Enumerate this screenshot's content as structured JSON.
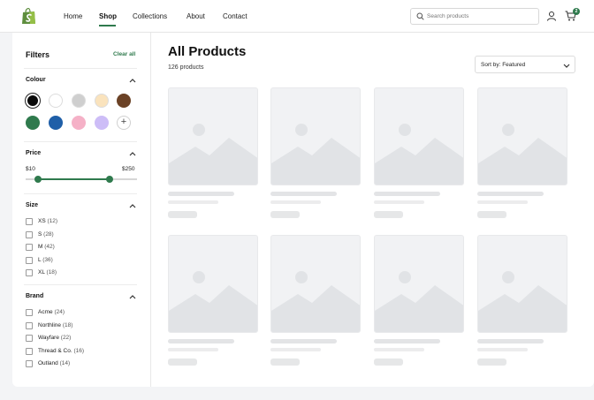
{
  "header": {
    "logo_icon": "shopify-bag-icon",
    "nav": [
      {
        "label": "Home",
        "active": false
      },
      {
        "label": "Shop",
        "active": true
      },
      {
        "label": "Collections",
        "active": false
      },
      {
        "label": "About",
        "active": false
      },
      {
        "label": "Contact",
        "active": false
      }
    ],
    "search": {
      "placeholder": "Search products",
      "icon": "search-icon"
    },
    "user_icon": "user-icon",
    "cart": {
      "icon": "cart-icon",
      "count": "2"
    }
  },
  "sidebar": {
    "title": "Filters",
    "clear_all": "Clear all",
    "colour": {
      "title": "Colour",
      "swatches": [
        {
          "name": "black",
          "hex": "#0a0a0a",
          "selected": true
        },
        {
          "name": "white",
          "hex": "#ffffff",
          "selected": false
        },
        {
          "name": "grey",
          "hex": "#cfcfcf",
          "selected": false
        },
        {
          "name": "beige",
          "hex": "#fae3bd",
          "selected": false
        },
        {
          "name": "brown",
          "hex": "#6b4226",
          "selected": false
        },
        {
          "name": "green",
          "hex": "#2f7a4d",
          "selected": false
        },
        {
          "name": "blue",
          "hex": "#1f5fa8",
          "selected": false
        },
        {
          "name": "pink",
          "hex": "#f5b1c7",
          "selected": false
        },
        {
          "name": "lavender",
          "hex": "#cdbdf7",
          "selected": false
        }
      ],
      "add_label": "+"
    },
    "price": {
      "title": "Price",
      "min_label": "$10",
      "max_label": "$250",
      "range_min": 10,
      "range_max": 250
    },
    "size": {
      "title": "Size",
      "options": [
        {
          "label": "XS",
          "count": "(12)"
        },
        {
          "label": "S",
          "count": "(28)"
        },
        {
          "label": "M",
          "count": "(42)"
        },
        {
          "label": "L",
          "count": "(36)"
        },
        {
          "label": "XL",
          "count": "(18)"
        }
      ]
    },
    "brand": {
      "title": "Brand",
      "options": [
        {
          "label": "Acme",
          "count": "(24)"
        },
        {
          "label": "Northline",
          "count": "(18)"
        },
        {
          "label": "Wayfare",
          "count": "(22)"
        },
        {
          "label": "Thread & Co.",
          "count": "(16)"
        },
        {
          "label": "Outland",
          "count": "(14)"
        }
      ]
    }
  },
  "main": {
    "title": "All Products",
    "count": "126 products",
    "sort_label": "Sort by: Featured"
  },
  "colors": {
    "accent": "#2f7a4d"
  }
}
